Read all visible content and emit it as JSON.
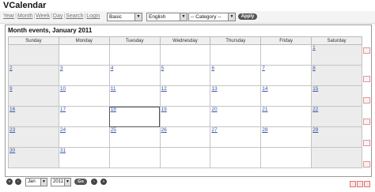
{
  "app": {
    "title": "VCalendar"
  },
  "nav": [
    "Year",
    "Month",
    "Week",
    "Day",
    "Search",
    "Login"
  ],
  "filters": {
    "style": "Basic",
    "language": "English",
    "category": "-- Category --",
    "apply": "Apply"
  },
  "calendar": {
    "title": "Month events, January 2011",
    "weekdays": [
      "Sunday",
      "Monday",
      "Tuesday",
      "Wednesday",
      "Thursday",
      "Friday",
      "Saturday"
    ],
    "weeks": [
      [
        "",
        "",
        "",
        "",
        "",
        "",
        "1"
      ],
      [
        "2",
        "3",
        "4",
        "5",
        "6",
        "7",
        "8"
      ],
      [
        "9",
        "10",
        "11",
        "12",
        "13",
        "14",
        "15"
      ],
      [
        "16",
        "17",
        "18",
        "19",
        "20",
        "21",
        "22"
      ],
      [
        "23",
        "24",
        "25",
        "26",
        "27",
        "28",
        "29"
      ],
      [
        "30",
        "31",
        "",
        "",
        "",
        "",
        ""
      ]
    ]
  },
  "bottom": {
    "month": "Jan",
    "year": "2011",
    "go": "Go"
  },
  "colors": {
    "link": "#3355aa",
    "weekend_bg": "#ececec",
    "button": "#555555"
  }
}
